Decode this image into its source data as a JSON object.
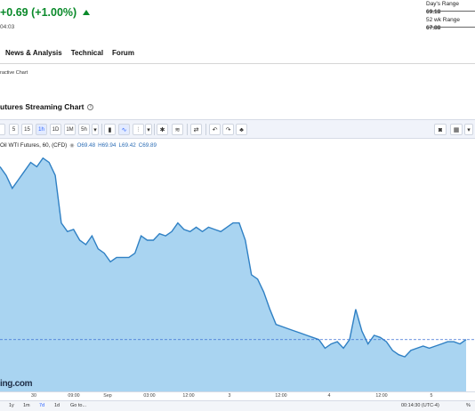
{
  "header": {
    "price_change": "+0.69 (+1.00%)",
    "time": "04:03",
    "days_range": {
      "label": "Day's Range",
      "value": "69.18"
    },
    "week52_range": {
      "label": "52 wk Range",
      "value": "67.88"
    }
  },
  "nav": {
    "items": [
      "News & Analysis",
      "Technical",
      "Forum"
    ]
  },
  "sub_link": "ractive Chart",
  "chart_title": "utures Streaming Chart",
  "toolbar": {
    "intervals": [
      "5",
      "15",
      "1h",
      "1D",
      "1M",
      "5h"
    ],
    "active_interval": "1h"
  },
  "legend": {
    "symbol": "Oil WTI Futures, 60, (CFD)",
    "open": "O69.48",
    "high": "H69.94",
    "low": "L69.42",
    "close": "C69.89"
  },
  "chart_data": {
    "type": "area",
    "x_tick_labels": [
      "30",
      "09:00",
      "Sep",
      "03:00",
      "12:00",
      "3",
      "12:00",
      "4",
      "12:00",
      "5"
    ],
    "series": [
      {
        "values": [
          72.5,
          72.3,
          72.0,
          72.2,
          72.4,
          72.6,
          72.5,
          72.7,
          72.6,
          72.3,
          71.2,
          71.0,
          71.05,
          70.8,
          70.7,
          70.9,
          70.6,
          70.5,
          70.3,
          70.4,
          70.4,
          70.4,
          70.5,
          70.9,
          70.8,
          70.8,
          70.95,
          70.9,
          71.0,
          71.2,
          71.05,
          71.0,
          71.1,
          71.0,
          71.1,
          71.05,
          71.0,
          71.1,
          71.2,
          71.2,
          70.8,
          70.0,
          69.9,
          69.6,
          69.2,
          68.85,
          68.8,
          68.75,
          68.7,
          68.65,
          68.6,
          68.55,
          68.5,
          68.3,
          68.4,
          68.45,
          68.3,
          68.5,
          69.2,
          68.7,
          68.4,
          68.6,
          68.55,
          68.45,
          68.25,
          68.15,
          68.1,
          68.25,
          68.3,
          68.35,
          68.3,
          68.35,
          68.4,
          68.45,
          68.45,
          68.4,
          68.5
        ]
      }
    ],
    "watermark": "ing.com",
    "colors": {
      "line": "#2f80c4",
      "fill": "#a9d4f1",
      "crosshair": "#3b6fd4"
    }
  },
  "bottom_bar": {
    "ranges": [
      "1y",
      "1m",
      "7d",
      "1d",
      "Go to..."
    ],
    "active_range": "7d",
    "clock": "00:14:30 (UTC-4)",
    "percent": "%"
  }
}
